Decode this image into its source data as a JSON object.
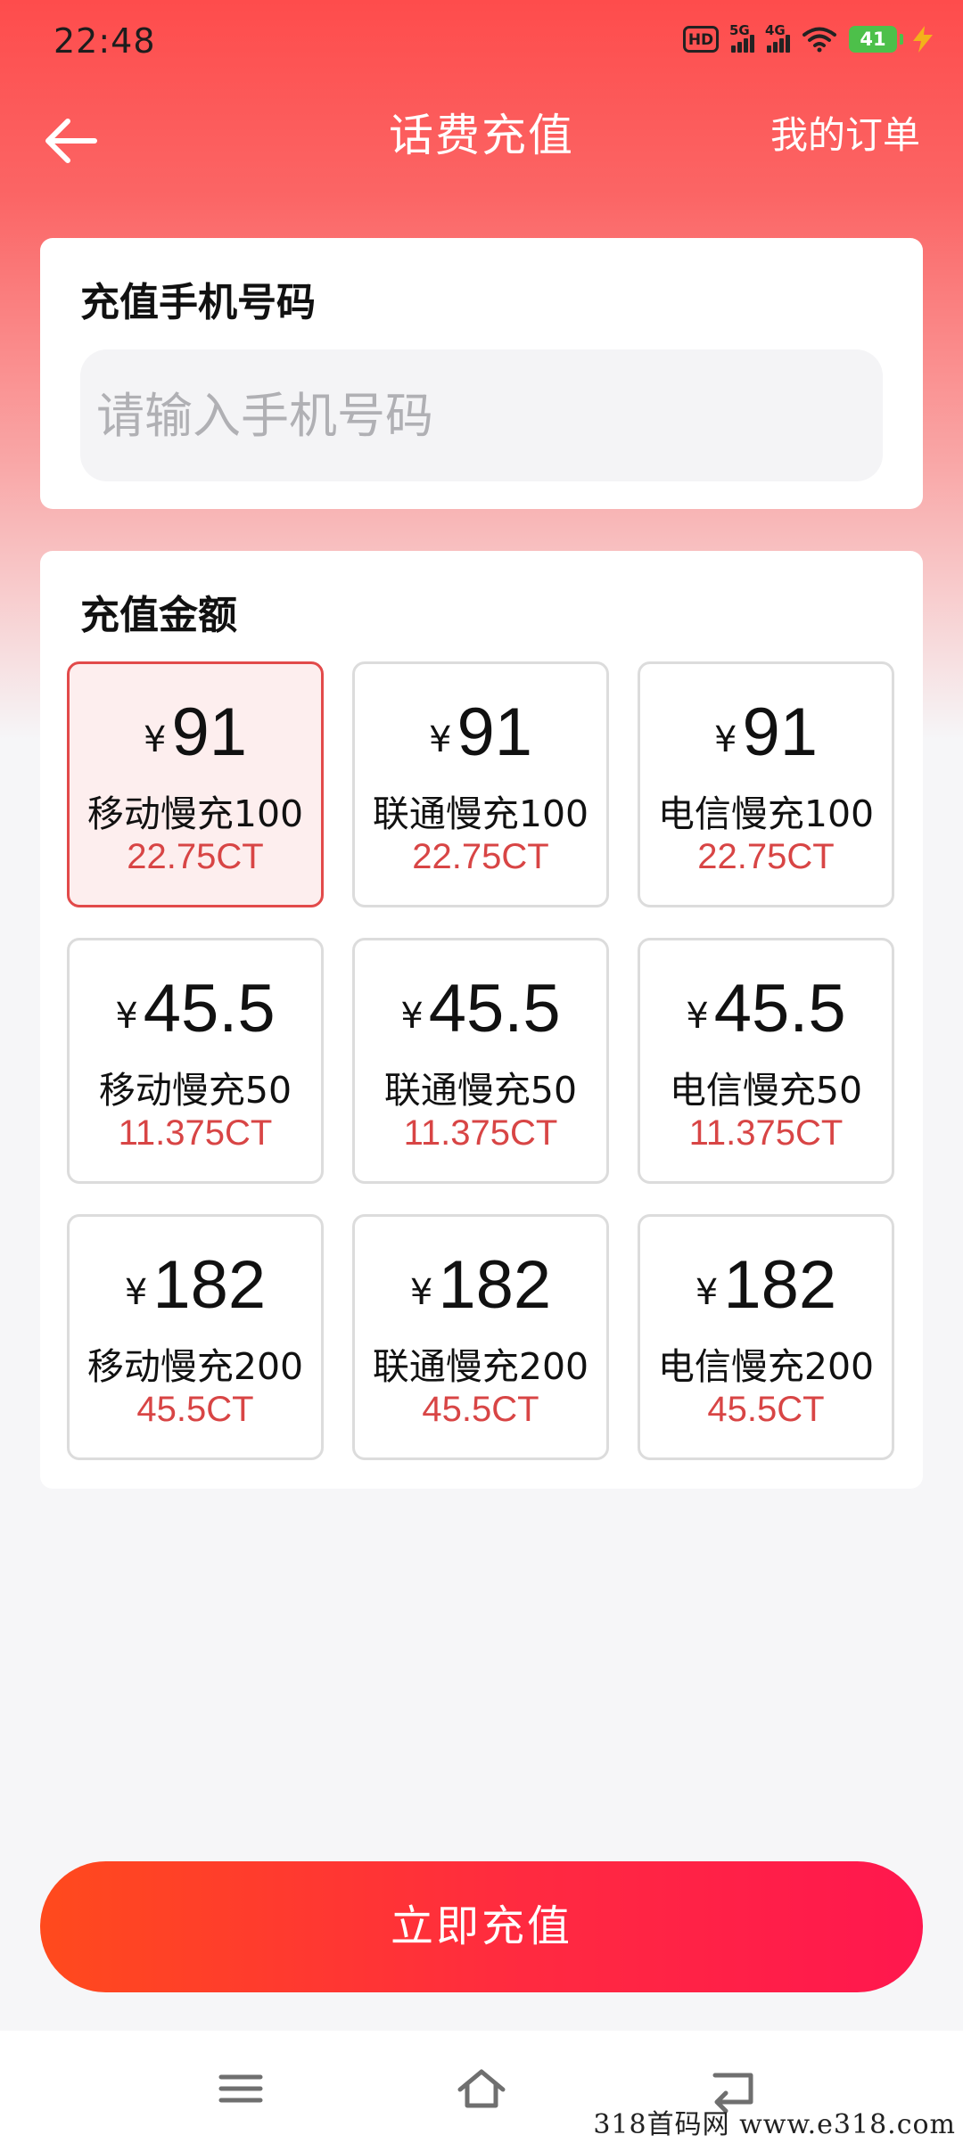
{
  "status_bar": {
    "time": "22:48",
    "hd_label": "HD",
    "sim1_label": "5G",
    "sim2_label": "4G",
    "battery": "41"
  },
  "header": {
    "title": "话费充值",
    "orders_link": "我的订单"
  },
  "phone_card": {
    "title": "充值手机号码",
    "placeholder": "请输入手机号码",
    "value": ""
  },
  "amount_card": {
    "title": "充值金额",
    "currency": "¥",
    "options": [
      {
        "price": "91",
        "name": "移动慢充100",
        "ct": "22.75CT",
        "selected": true
      },
      {
        "price": "91",
        "name": "联通慢充100",
        "ct": "22.75CT",
        "selected": false
      },
      {
        "price": "91",
        "name": "电信慢充100",
        "ct": "22.75CT",
        "selected": false
      },
      {
        "price": "45.5",
        "name": "移动慢充50",
        "ct": "11.375CT",
        "selected": false
      },
      {
        "price": "45.5",
        "name": "联通慢充50",
        "ct": "11.375CT",
        "selected": false
      },
      {
        "price": "45.5",
        "name": "电信慢充50",
        "ct": "11.375CT",
        "selected": false
      },
      {
        "price": "182",
        "name": "移动慢充200",
        "ct": "45.5CT",
        "selected": false
      },
      {
        "price": "182",
        "name": "联通慢充200",
        "ct": "45.5CT",
        "selected": false
      },
      {
        "price": "182",
        "name": "电信慢充200",
        "ct": "45.5CT",
        "selected": false
      }
    ]
  },
  "recharge_button": "立即充值",
  "navbar": {
    "icons": [
      "menu-icon",
      "home-icon",
      "back-icon"
    ]
  },
  "watermark": "318首码网  www.e318.com",
  "colors": {
    "accent": "#fe4c4c",
    "price_text": "#d84545",
    "selected_border": "#e24a4a",
    "button_start": "#ff4a1d",
    "button_end": "#ff174e"
  }
}
